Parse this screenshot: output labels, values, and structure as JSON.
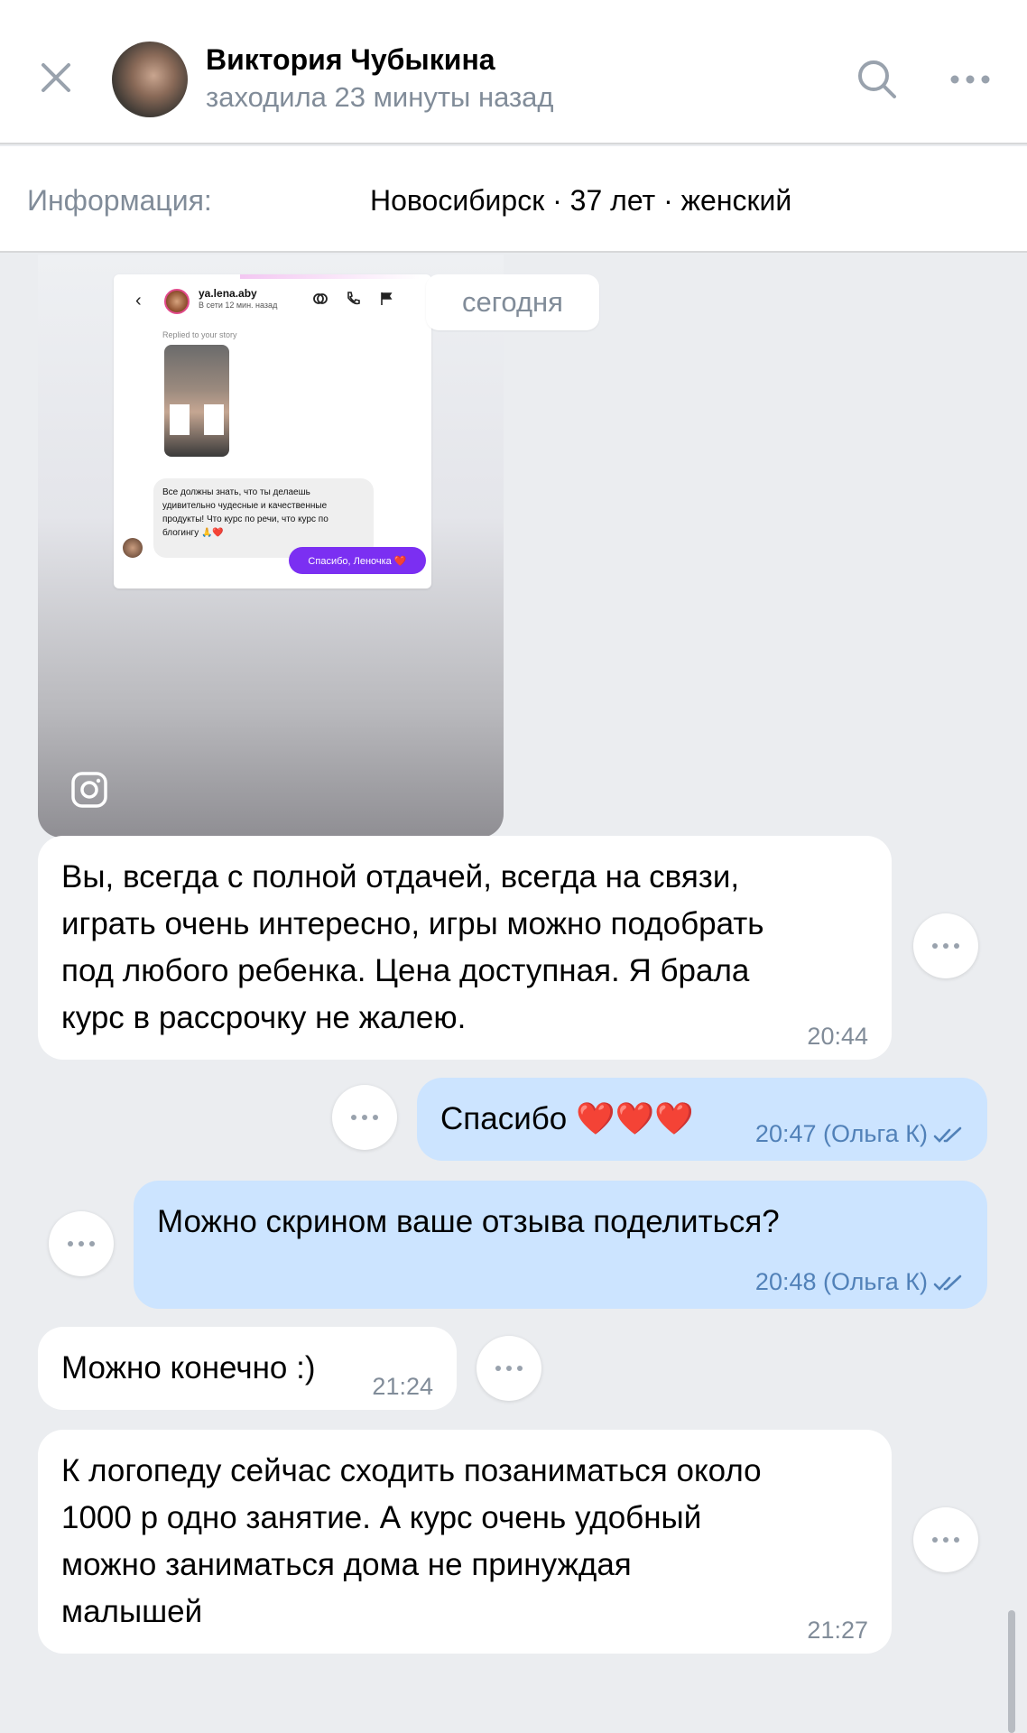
{
  "header": {
    "name": "Виктория Чубыкина",
    "status": "заходила 23 минуты назад"
  },
  "info": {
    "label": "Информация:",
    "value": "Новосибирск · 37 лет · женский"
  },
  "story": {
    "username": "ya.lena.aby",
    "online": "В сети 12 мин. назад",
    "replied": "Replied to your story",
    "message": "Все должны знать, что ты делаешь удивительно чудесные и качественные продукты! Что курс по речи, что курс по блогингу 🙏❤️",
    "reply": "Спасибо, Леночка ❤️"
  },
  "date_separator": "сегодня",
  "messages": [
    {
      "lines": [
        "Вы, всегда с полной отдачей, всегда на связи,",
        "играть очень интересно, игры можно подобрать",
        "под любого ребенка. Цена доступная. Я брала",
        "курс в рассрочку не жалею."
      ],
      "time": "20:44"
    },
    {
      "text": "Спасибо ❤️❤️❤️",
      "time": "20:47 (Ольга К)"
    },
    {
      "text": "Можно скрином ваше отзыва  поделиться?",
      "time": "20:48 (Ольга К)"
    },
    {
      "text": "Можно конечно :)",
      "time": "21:24"
    },
    {
      "lines": [
        "К логопеду сейчас сходить позаниматься около",
        "1000 р одно занятие. А курс очень удобный",
        "можно заниматься дома не принуждая",
        "малышей"
      ],
      "time": "21:27"
    }
  ]
}
